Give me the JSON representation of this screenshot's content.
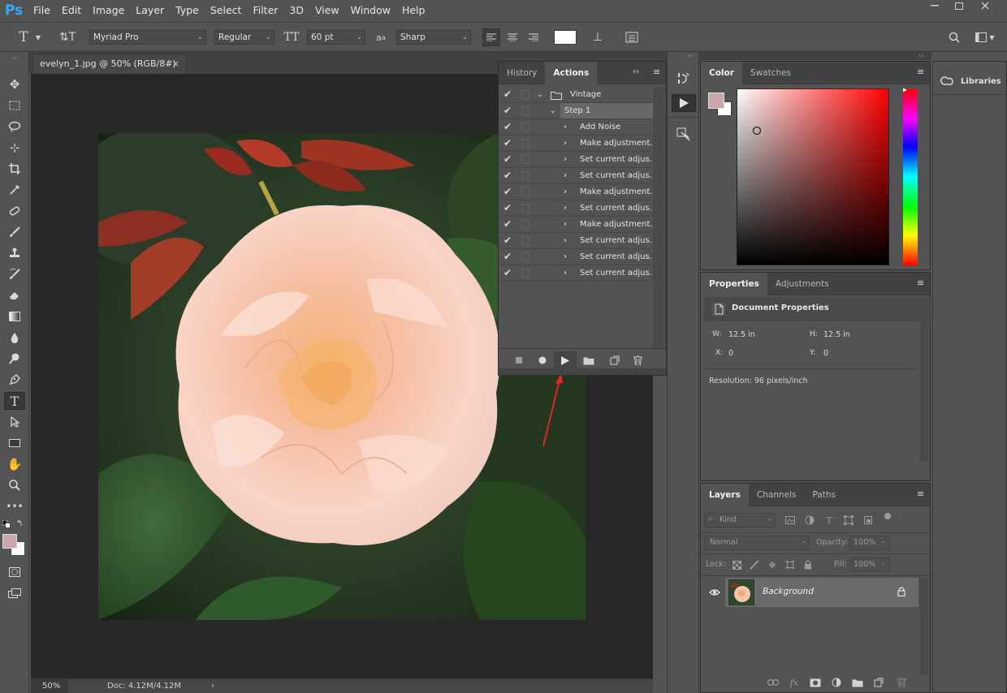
{
  "app": {
    "logo": "Ps"
  },
  "menu": [
    "File",
    "Edit",
    "Image",
    "Layer",
    "Type",
    "Select",
    "Filter",
    "3D",
    "View",
    "Window",
    "Help"
  ],
  "options_bar": {
    "font_family": "Myriad Pro",
    "font_style": "Regular",
    "font_size": "60 pt",
    "anti_alias": "Sharp",
    "aa_label": "a",
    "aa_label2": "a"
  },
  "document": {
    "tab_title": "evelyn_1.jpg @ 50% (RGB/8#)",
    "close": "×",
    "zoom": "50%",
    "doc_size": "Doc: 4.12M/4.12M"
  },
  "actions_panel": {
    "tabs": [
      "History",
      "Actions"
    ],
    "set_name": "Vintage",
    "action_name": "Step 1",
    "steps": [
      "Add Noise",
      "Make adjustment...",
      "Set current adjus...",
      "Set current adjus...",
      "Make adjustment...",
      "Set current adjus...",
      "Make adjustment...",
      "Set current adjus...",
      "Set current adjus...",
      "Set current adjus..."
    ]
  },
  "color_panel": {
    "tabs": [
      "Color",
      "Swatches"
    ],
    "foreground": "#c9a7a9",
    "background": "#ffffff",
    "hue": "#ff0000"
  },
  "libraries": {
    "label": "Libraries"
  },
  "properties_panel": {
    "tabs": [
      "Properties",
      "Adjustments"
    ],
    "title": "Document Properties",
    "w_label": "W:",
    "w_value": "12.5 in",
    "h_label": "H:",
    "h_value": "12.5 in",
    "x_label": "X:",
    "x_value": "0",
    "y_label": "Y:",
    "y_value": "0",
    "resolution": "Resolution: 96 pixels/inch"
  },
  "layers_panel": {
    "tabs": [
      "Layers",
      "Channels",
      "Paths"
    ],
    "filter_kind": "Kind",
    "blend_mode": "Normal",
    "opacity_label": "Opacity:",
    "opacity_value": "100%",
    "lock_label": "Lock:",
    "fill_label": "Fill:",
    "fill_value": "100%",
    "layer_name": "Background"
  },
  "colors": {
    "accent": "#31a8ff",
    "arrow": "#e8212a"
  }
}
